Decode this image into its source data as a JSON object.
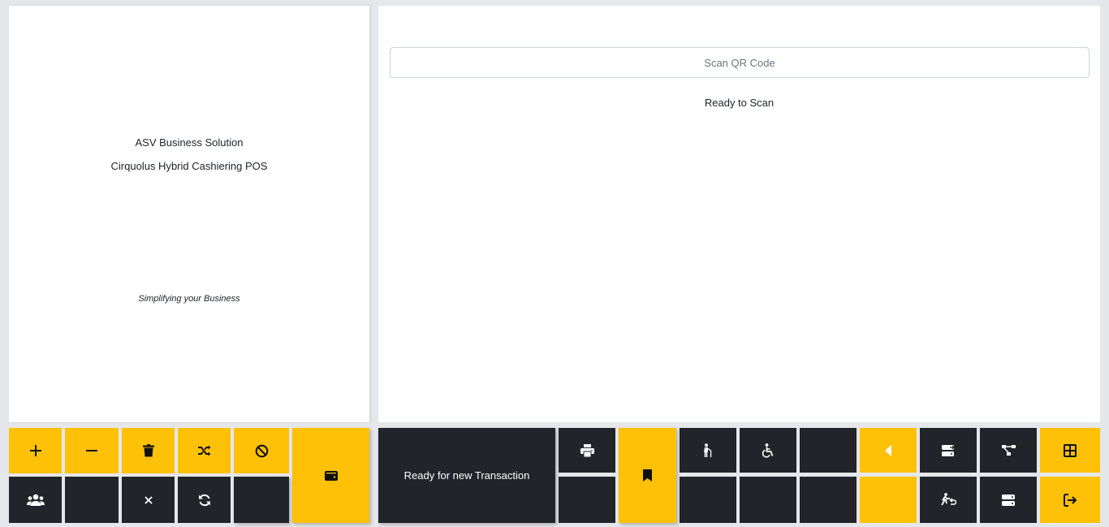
{
  "header": {
    "company": "ASV Business Solution",
    "product": "Cirquolus Hybrid Cashiering POS",
    "tagline": "Simplifying your Business"
  },
  "scanner": {
    "placeholder": "Scan QR Code",
    "status": "Ready to Scan"
  },
  "transaction": {
    "status": "Ready for new Transaction"
  },
  "colors": {
    "accent": "#ffc107",
    "dark": "#212529",
    "background": "#e6e7ea",
    "panel": "#ffffff"
  },
  "toolbar_left": [
    {
      "icon": "plus-icon",
      "style": "accent"
    },
    {
      "icon": "minus-icon",
      "style": "accent"
    },
    {
      "icon": "trash-icon",
      "style": "accent"
    },
    {
      "icon": "shuffle-icon",
      "style": "accent"
    },
    {
      "icon": "ban-icon",
      "style": "accent"
    },
    {
      "icon": "wallet-icon",
      "style": "accent"
    },
    {
      "icon": "users-icon",
      "style": "dark"
    },
    {
      "icon": "blank",
      "style": "dark"
    },
    {
      "icon": "times-icon",
      "style": "dark"
    },
    {
      "icon": "sync-icon",
      "style": "dark"
    },
    {
      "icon": "blank",
      "style": "dark"
    }
  ],
  "toolbar_right": [
    {
      "icon": "print-icon",
      "style": "dark"
    },
    {
      "icon": "bookmark-icon",
      "style": "accent"
    },
    {
      "icon": "person-cane-icon",
      "style": "dark"
    },
    {
      "icon": "wheelchair-icon",
      "style": "dark"
    },
    {
      "icon": "blank",
      "style": "dark"
    },
    {
      "icon": "caret-left-icon",
      "style": "accent"
    },
    {
      "icon": "server-transfer-icon",
      "style": "dark"
    },
    {
      "icon": "network-icon",
      "style": "dark"
    },
    {
      "icon": "table-icon",
      "style": "accent"
    },
    {
      "icon": "exit-icon",
      "style": "accent"
    }
  ]
}
